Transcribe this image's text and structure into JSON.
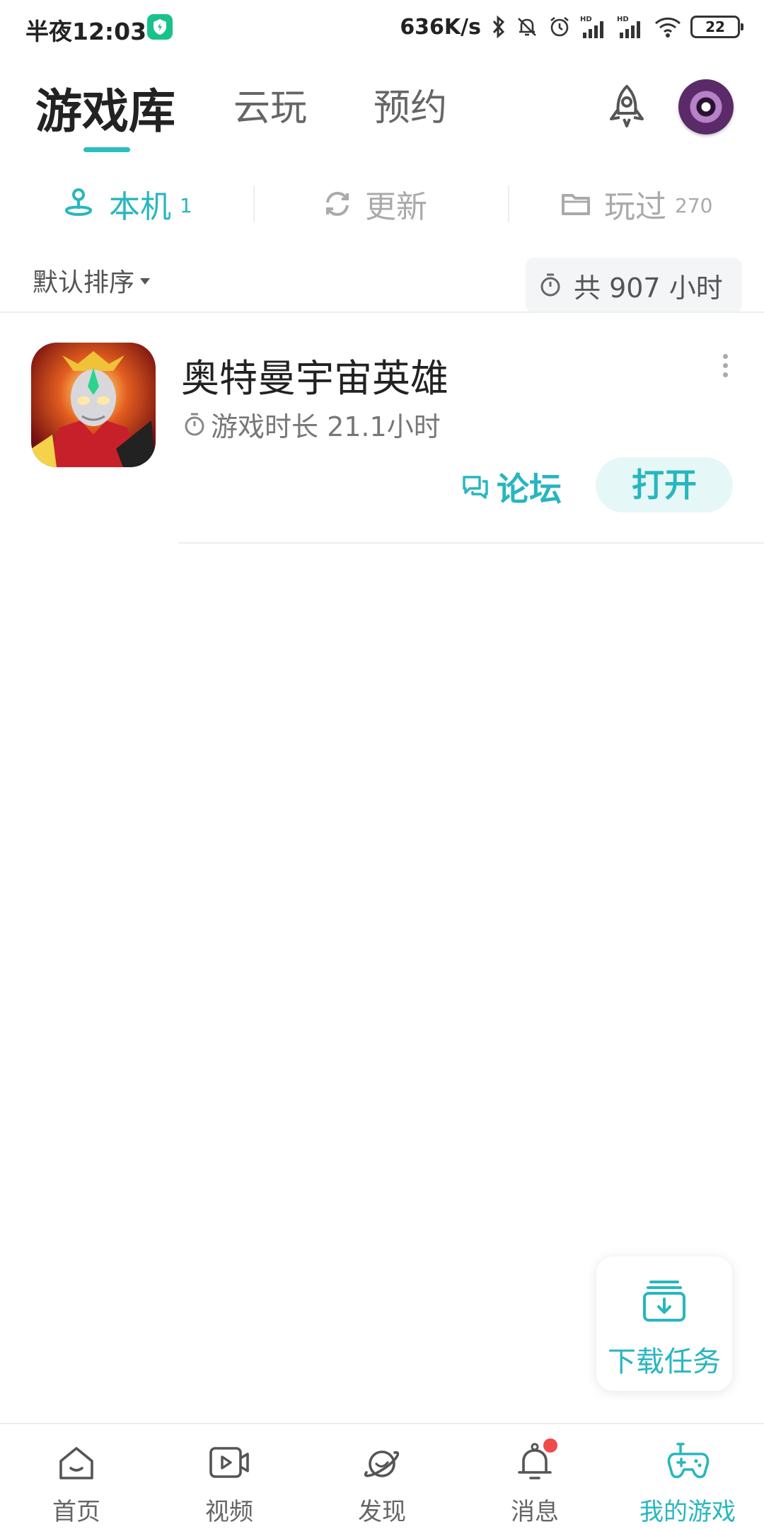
{
  "status_bar": {
    "time": "半夜12:03",
    "net_speed": "636K/s",
    "battery": "22",
    "icons": [
      "shield-icon",
      "bluetooth-icon",
      "mute-bell-icon",
      "alarm-icon",
      "hd-signal-icon",
      "hd-signal-icon",
      "wifi-icon",
      "battery-icon"
    ]
  },
  "header": {
    "tabs": [
      {
        "label": "游戏库",
        "active": true
      },
      {
        "label": "云玩",
        "active": false
      },
      {
        "label": "预约",
        "active": false
      }
    ],
    "accent_color": "#28b6be"
  },
  "sub_tabs": [
    {
      "label": "本机",
      "count": "1",
      "icon": "joystick-icon",
      "active": true
    },
    {
      "label": "更新",
      "count": "",
      "icon": "refresh-icon",
      "active": false
    },
    {
      "label": "玩过",
      "count": "270",
      "icon": "folder-icon",
      "active": false
    }
  ],
  "sort": {
    "label": "默认排序",
    "total_time": "共 907 小时"
  },
  "games": [
    {
      "title": "奥特曼宇宙英雄",
      "play_time": "游戏时长 21.1小时",
      "forum_label": "论坛",
      "open_label": "打开"
    }
  ],
  "download_fab": {
    "label": "下载任务"
  },
  "bottom_nav": [
    {
      "label": "首页",
      "icon": "home-icon",
      "active": false
    },
    {
      "label": "视频",
      "icon": "video-icon",
      "active": false
    },
    {
      "label": "发现",
      "icon": "planet-icon",
      "active": false
    },
    {
      "label": "消息",
      "icon": "bell-icon",
      "active": false,
      "badge": true
    },
    {
      "label": "我的游戏",
      "icon": "gamepad-icon",
      "active": true
    }
  ]
}
